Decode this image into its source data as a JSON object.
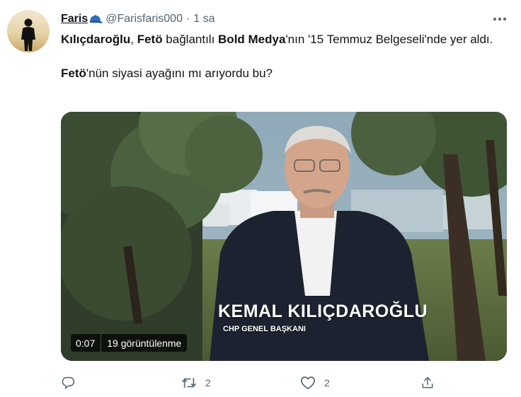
{
  "user": {
    "display_name": "Faris",
    "handle": "@Farisfaris000",
    "separator": "·",
    "time": "1 sa"
  },
  "icons": {
    "avatar": "person-silhouette-avatar",
    "badge": "blue-cap-emoji",
    "more": "more-dots-icon",
    "reply": "reply-icon",
    "retweet": "retweet-icon",
    "like": "heart-icon",
    "share": "share-icon"
  },
  "tweet": {
    "line1": {
      "b1": "Kılıçdaroğlu",
      "t1": ", ",
      "b2": "Fetö",
      "t2": " bağlantılı ",
      "b3": "Bold Medya",
      "t3": "'nın '15 Temmuz Belgeseli'nde yer aldı."
    },
    "line2": {
      "b1": "Fetö",
      "t1": "'nün siyasi ayağını mı arıyordu bu?"
    }
  },
  "video": {
    "name_caption": "KEMAL KILIÇDAROĞLU",
    "title_caption": "CHP GENEL BAŞKANI",
    "duration": "0:07",
    "views": "19 görüntülenme"
  },
  "actions": {
    "reply_count": "",
    "retweet_count": "2",
    "like_count": "2",
    "share_count": ""
  },
  "colors": {
    "text": "#0f1419",
    "secondary": "#536471",
    "cap_blue": "#2f6fb5"
  }
}
